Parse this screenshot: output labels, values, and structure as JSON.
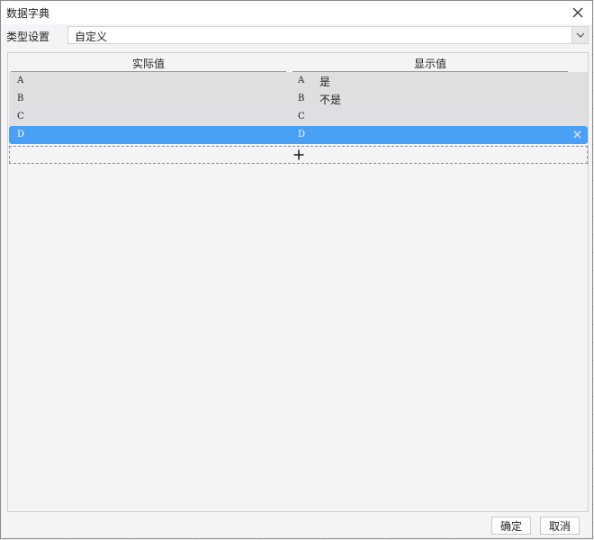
{
  "window": {
    "title": "数据字典"
  },
  "type_setting": {
    "label": "类型设置",
    "selected": "自定义"
  },
  "table": {
    "columns": [
      "实际值",
      "显示值"
    ],
    "rows": [
      {
        "actual": "A",
        "display_key": "A",
        "display_value": "是",
        "selected": false
      },
      {
        "actual": "B",
        "display_key": "B",
        "display_value": "不是",
        "selected": false
      },
      {
        "actual": "C",
        "display_key": "C",
        "display_value": "",
        "selected": false
      },
      {
        "actual": "D",
        "display_key": "D",
        "display_value": "",
        "selected": true
      }
    ]
  },
  "icons": {
    "close": "close-icon",
    "dropdown": "chevron-down-icon",
    "add": "plus-icon",
    "delete": "remove-icon"
  },
  "buttons": {
    "ok": "确定",
    "cancel": "取消"
  },
  "colors": {
    "selected_row": "#4aa0f5",
    "row_bg": "#dfdfe1"
  }
}
